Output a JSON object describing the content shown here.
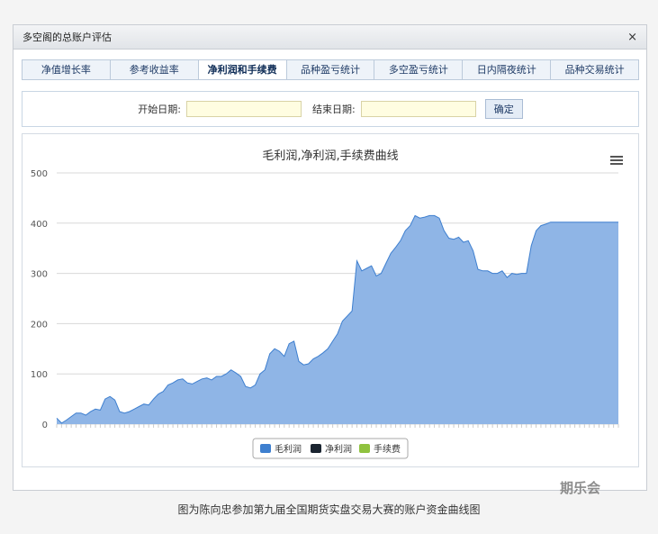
{
  "dialog": {
    "title": "多空阁的总账户评估",
    "close_label": "×"
  },
  "tabs": [
    {
      "label": "净值增长率"
    },
    {
      "label": "参考收益率"
    },
    {
      "label": "净利润和手续费"
    },
    {
      "label": "品种盈亏统计"
    },
    {
      "label": "多空盈亏统计"
    },
    {
      "label": "日内隔夜统计"
    },
    {
      "label": "品种交易统计"
    }
  ],
  "active_tab": 2,
  "filter": {
    "start_label": "开始日期:",
    "end_label": "结束日期:",
    "start_value": "",
    "end_value": "",
    "confirm_label": "确定"
  },
  "chart_data": {
    "type": "area",
    "title": "毛利润,净利润,手续费曲线",
    "ylim": [
      0,
      500
    ],
    "yticks": [
      0,
      100,
      200,
      300,
      400,
      500
    ],
    "grid": true,
    "legend_placement": "bottom-center",
    "series": [
      {
        "name": "毛利润",
        "color": "#3e7fcf",
        "fill": "#8fb5e6",
        "values": [
          12,
          2,
          8,
          15,
          22,
          22,
          18,
          25,
          30,
          28,
          50,
          55,
          48,
          25,
          22,
          25,
          30,
          35,
          40,
          38,
          50,
          60,
          65,
          78,
          82,
          88,
          90,
          82,
          80,
          85,
          90,
          92,
          88,
          95,
          95,
          100,
          108,
          102,
          95,
          75,
          72,
          78,
          100,
          108,
          140,
          150,
          145,
          135,
          160,
          165,
          125,
          118,
          120,
          130,
          135,
          142,
          150,
          165,
          180,
          205,
          215,
          225,
          325,
          305,
          310,
          315,
          295,
          300,
          320,
          340,
          352,
          365,
          385,
          395,
          415,
          410,
          412,
          415,
          415,
          410,
          385,
          370,
          368,
          372,
          362,
          365,
          345,
          308,
          305,
          305,
          300,
          300,
          305,
          292,
          300,
          298,
          300,
          300,
          355,
          385,
          395,
          398,
          402,
          402,
          402,
          402,
          402,
          402,
          402,
          402,
          402,
          402,
          402,
          402,
          402,
          402,
          402
        ]
      },
      {
        "name": "净利润",
        "color": "#1a2430",
        "fill": "none",
        "values": []
      },
      {
        "name": "手续费",
        "color": "#8fc23f",
        "fill": "none",
        "values": []
      }
    ]
  },
  "caption": "图为陈向忠参加第九届全国期货实盘交易大赛的账户资金曲线图",
  "watermark": "期乐会",
  "icons": {
    "menu": "hamburger-menu-icon",
    "close": "close-icon"
  }
}
